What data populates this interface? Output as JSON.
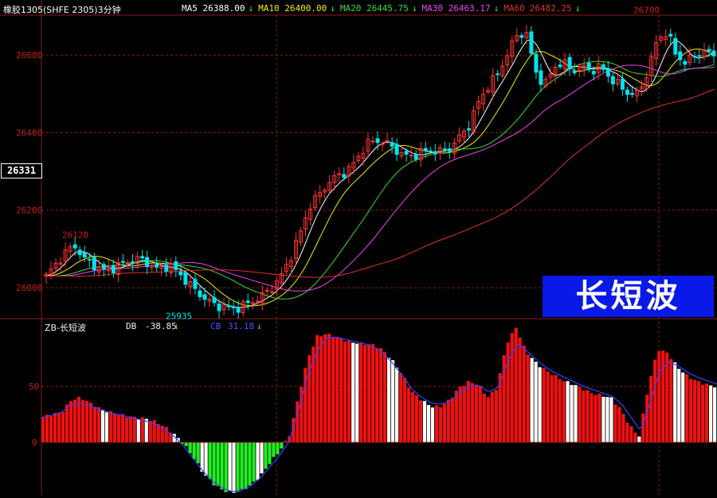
{
  "title": "橡胶1305(SHFE 2305)3分钟",
  "ma_legend": [
    {
      "label": "MA5 26388.00",
      "arrow": "↓",
      "color": "#ffffff"
    },
    {
      "label": "MA10 26400.00",
      "arrow": "↓",
      "color": "#f0f000"
    },
    {
      "label": "MA20 26445.75",
      "arrow": "↓",
      "color": "#33dd33"
    },
    {
      "label": "MA30 26463.17",
      "arrow": "↓",
      "color": "#ee44ee"
    },
    {
      "label": "MA60",
      "arrow": "",
      "color": "#e03030"
    },
    {
      "label": "26482.25",
      "arrow": "↓",
      "color": "#e03030"
    }
  ],
  "current_price": "26331",
  "banner_text": "长短波",
  "indicator": {
    "name": "ZB-长短波",
    "db_label": "DB",
    "db_value": "-38.85",
    "db_arrow": "↓",
    "cb_label": "CB",
    "cb_value": "31.18",
    "cb_arrow": "↓"
  },
  "colors": {
    "up": "#ff3333",
    "down": "#00e5ee",
    "bar_pos": "#ee1111",
    "bar_neg": "#22ee22",
    "cb_line": "#3344ff",
    "grid": "#8c1a1a",
    "axis_text": "#c81e1e"
  },
  "chart_data": [
    {
      "type": "candlestick",
      "title": "橡胶1305(SHFE 2305)3分钟",
      "y_ticks": [
        26000,
        26200,
        26400,
        26600
      ],
      "ylim": [
        25920,
        26705
      ],
      "annotations": [
        {
          "text": "26120",
          "value": 26120
        },
        {
          "text": "25935",
          "value": 25935
        },
        {
          "text": "26700",
          "value": 26700
        }
      ],
      "close_path": [
        26030,
        26060,
        26090,
        26110,
        26075,
        26060,
        26045,
        26050,
        26060,
        26070,
        26075,
        26060,
        26045,
        26060,
        26040,
        26015,
        25990,
        25970,
        25955,
        25950,
        25945,
        25955,
        25965,
        25980,
        26000,
        26030,
        26080,
        26140,
        26210,
        26240,
        26270,
        26290,
        26300,
        26330,
        26370,
        26380,
        26375,
        26360,
        26340,
        26340,
        26350,
        26355,
        26350,
        26360,
        26390,
        26420,
        26480,
        26520,
        26550,
        26600,
        26650,
        26660,
        26560,
        26520,
        26570,
        26580,
        26560,
        26570,
        26560,
        26570,
        26540,
        26520,
        26500,
        26500,
        26560,
        26640,
        26660,
        26600,
        26580,
        26600,
        26610,
        26600
      ],
      "series": [
        {
          "name": "MA5",
          "color": "#ffffff",
          "offset": 0.5
        },
        {
          "name": "MA10",
          "color": "#f0f000",
          "offset": 1.5
        },
        {
          "name": "MA20",
          "color": "#33dd33",
          "offset": 4
        },
        {
          "name": "MA30",
          "color": "#ee44ee",
          "offset": 6
        },
        {
          "name": "MA60",
          "color": "#e03030",
          "offset": 14
        }
      ]
    },
    {
      "type": "bar",
      "title": "ZB-长短波",
      "y_ticks": [
        0,
        50
      ],
      "ylim": [
        -47,
        102
      ],
      "bars_path": [
        23,
        25,
        27,
        38,
        40,
        35,
        30,
        27,
        25,
        23,
        22,
        21,
        18,
        13,
        6,
        -3,
        -15,
        -28,
        -37,
        -43,
        -45,
        -43,
        -38,
        -30,
        -18,
        -8,
        5,
        40,
        75,
        95,
        97,
        94,
        91,
        89,
        88,
        87,
        82,
        72,
        60,
        45,
        38,
        32,
        32,
        38,
        49,
        54,
        52,
        40,
        49,
        88,
        103,
        82,
        72,
        65,
        60,
        55,
        52,
        48,
        44,
        42,
        40,
        30,
        15,
        5,
        50,
        83,
        80,
        68,
        60,
        55,
        52,
        50
      ],
      "cb_path": [
        22,
        24,
        26,
        33,
        35,
        33,
        30,
        27,
        25,
        23,
        21,
        19,
        16,
        11,
        5,
        -4,
        -15,
        -26,
        -35,
        -41,
        -44,
        -43,
        -39,
        -32,
        -22,
        -12,
        0,
        28,
        60,
        82,
        94,
        94,
        92,
        90,
        88,
        85,
        79,
        70,
        59,
        47,
        40,
        35,
        34,
        37,
        45,
        50,
        51,
        45,
        49,
        72,
        88,
        82,
        74,
        67,
        62,
        58,
        54,
        50,
        47,
        44,
        41,
        34,
        22,
        10,
        36,
        64,
        72,
        68,
        62,
        58,
        55,
        52
      ]
    }
  ]
}
